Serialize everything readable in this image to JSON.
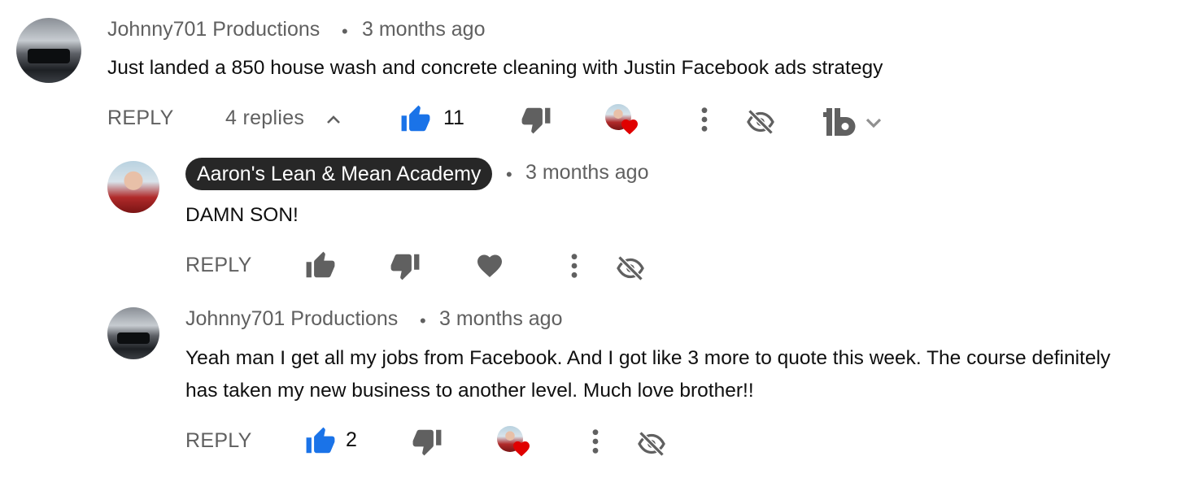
{
  "comments": [
    {
      "author": "Johnny701 Productions",
      "time": "3 months ago",
      "text": "Just landed a 850 house wash and concrete cleaning with Justin Facebook ads strategy",
      "reply_label": "REPLY",
      "replies_label": "4 replies",
      "likes": "11",
      "like_color": "#1a73e8",
      "icons": [
        "thumb-up-icon",
        "thumb-down-icon",
        "creator-heart-icon",
        "more-vert-icon",
        "hide-icon",
        "tubebuddy-icon",
        "chevron-down-icon"
      ]
    }
  ],
  "replies": [
    {
      "author": "Aaron's Lean & Mean Academy",
      "is_owner": true,
      "time": "3 months ago",
      "text": "DAMN SON!",
      "reply_label": "REPLY",
      "likes": "",
      "icons": [
        "thumb-up-icon",
        "thumb-down-icon",
        "heart-icon",
        "more-vert-icon",
        "hide-icon"
      ]
    },
    {
      "author": "Johnny701 Productions",
      "is_owner": false,
      "time": "3 months ago",
      "text_line1": "Yeah man I get all my jobs from Facebook. And I got like 3 more to quote this week. The course definitely",
      "text_line2": "has taken my new business to another level. Much love brother!!",
      "reply_label": "REPLY",
      "likes": "2",
      "like_color": "#1a73e8",
      "icons": [
        "thumb-up-icon",
        "thumb-down-icon",
        "creator-heart-icon",
        "more-vert-icon",
        "hide-icon"
      ]
    }
  ],
  "separator": "•",
  "colors": {
    "accent_blue": "#1a73e8",
    "heart_red": "#e00000",
    "owner_badge_bg": "#272727",
    "secondary_text": "#606060"
  }
}
